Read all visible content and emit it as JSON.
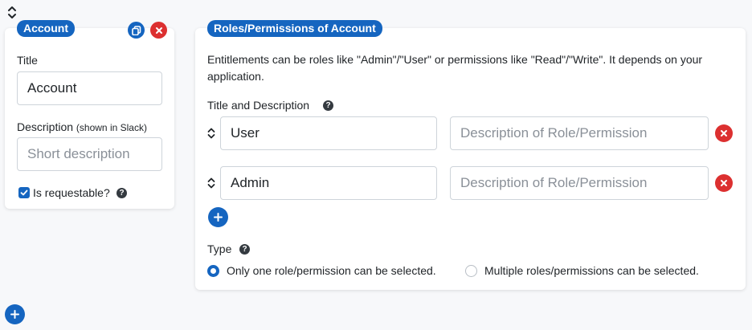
{
  "icons": {
    "sort": "up-down-chevron-icon",
    "copy": "copy-icon",
    "remove": "close-icon",
    "add": "plus-icon",
    "help": "question-circle-icon",
    "check": "checkmark-icon"
  },
  "colors": {
    "accent": "#1565c0",
    "danger": "#dc3030",
    "background": "#f7f8fa"
  },
  "account_card": {
    "badge": "Account",
    "title_label": "Title",
    "title_value": "Account",
    "description_label": "Description",
    "description_hint": "(shown in Slack)",
    "description_placeholder": "Short description",
    "requestable_label": "Is requestable?",
    "requestable_checked": true
  },
  "roles_card": {
    "badge": "Roles/Permissions of Account",
    "intro": "Entitlements can be roles like \"Admin\"/\"User\" or permissions like \"Read\"/\"Write\". It depends on your application.",
    "section_label": "Title and Description",
    "rows": [
      {
        "title": "User",
        "description_placeholder": "Description of Role/Permission"
      },
      {
        "title": "Admin",
        "description_placeholder": "Description of Role/Permission"
      }
    ],
    "type_label": "Type",
    "type_options": [
      {
        "label": "Only one role/permission can be selected.",
        "selected": true
      },
      {
        "label": "Multiple roles/permissions can be selected.",
        "selected": false
      }
    ]
  }
}
